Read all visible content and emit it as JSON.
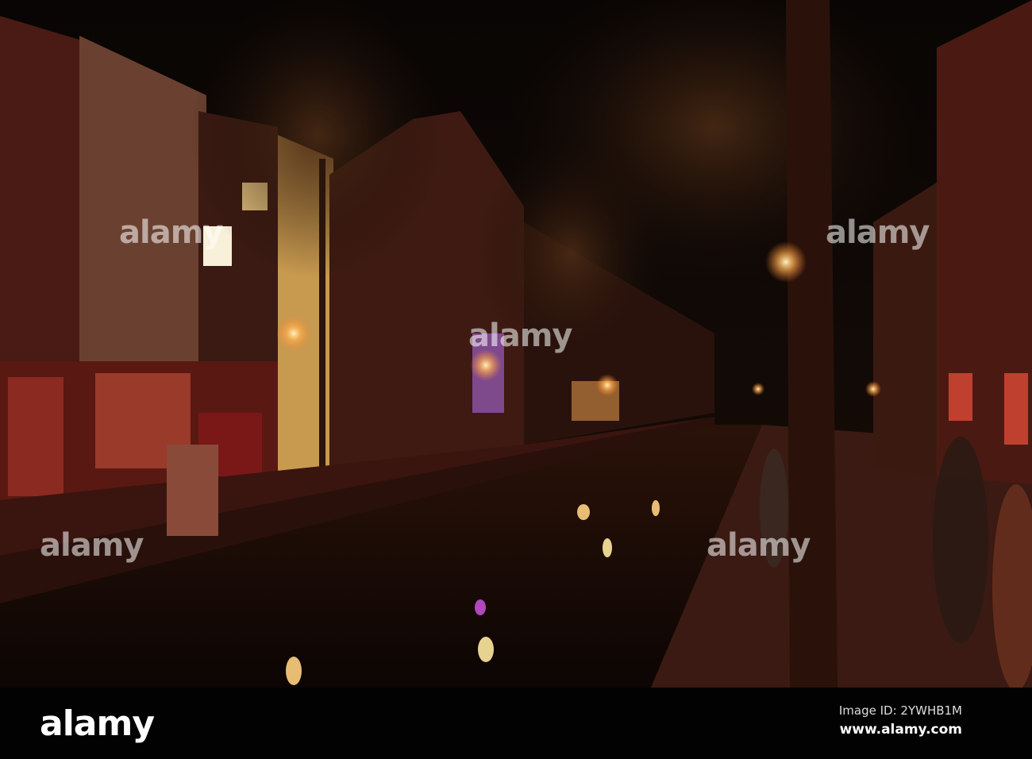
{
  "watermark": {
    "text": "alamy"
  },
  "footer": {
    "logo": "alamy",
    "image_id": "Image ID: 2YWHB1M",
    "website": "www.alamy.com"
  },
  "colors": {
    "sky": "#0b0806",
    "brick": "#5a2018",
    "lamp": "#ffd88a",
    "water": "#120806",
    "red_light": "#ff3030"
  }
}
